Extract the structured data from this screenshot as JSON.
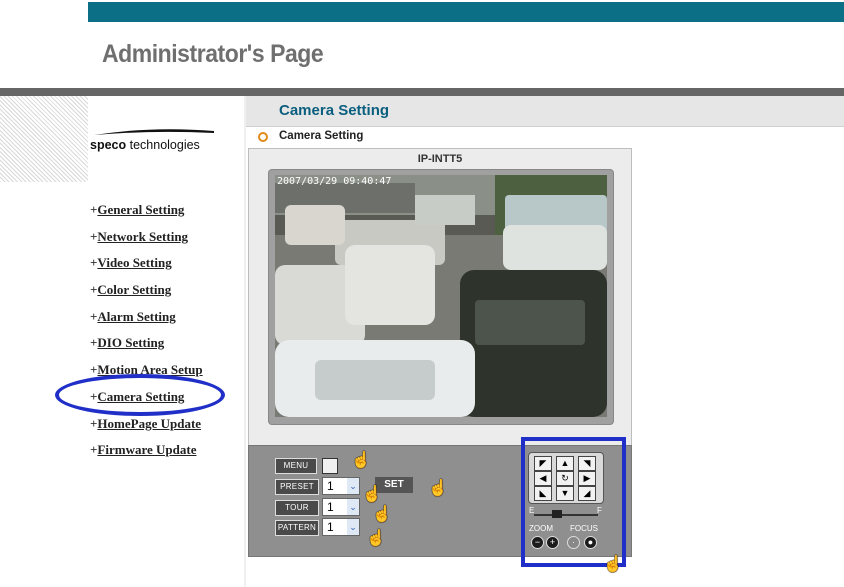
{
  "header": {
    "title": "Administrator's Page"
  },
  "brand": {
    "logo_bold": "speco",
    "logo_rest": " technologies"
  },
  "nav": {
    "items": [
      {
        "plus": "+",
        "label": "General Setting"
      },
      {
        "plus": "+",
        "label": "Network Setting"
      },
      {
        "plus": "+",
        "label": "Video Setting"
      },
      {
        "plus": "+",
        "label": "Color Setting"
      },
      {
        "plus": "+",
        "label": "Alarm Setting"
      },
      {
        "plus": "+",
        "label": "DIO Setting"
      },
      {
        "plus": "+",
        "label": "Motion Area Setup"
      },
      {
        "plus": "+",
        "label": "Camera Setting"
      },
      {
        "plus": "+",
        "label": "HomePage Update"
      },
      {
        "plus": "+",
        "label": "Firmware Update"
      }
    ]
  },
  "main": {
    "section_title": "Camera Setting",
    "breadcrumb": "Camera Setting",
    "camera_name": "IP-INTT5",
    "timestamp": "2007/03/29 09:40:47"
  },
  "controls": {
    "menu_label": "MENU",
    "preset_label": "PRESET",
    "tour_label": "TOUR",
    "pattern_label": "PATTERN",
    "preset_value": "1",
    "tour_value": "1",
    "pattern_value": "1",
    "set_label": "SET",
    "zoom_label": "ZOOM",
    "focus_label": "FOCUS",
    "slider_left": "E",
    "slider_right": "F"
  },
  "colors": {
    "teal": "#0b6f86",
    "highlight": "#1f2fc8",
    "accent": "#e08a1a"
  }
}
